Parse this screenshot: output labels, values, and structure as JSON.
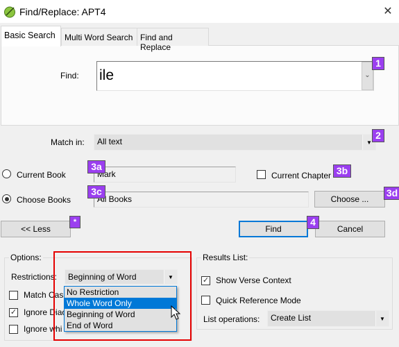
{
  "window": {
    "title": "Find/Replace: APT4",
    "close_glyph": "✕"
  },
  "tabs": [
    {
      "label": "Basic Search",
      "active": true
    },
    {
      "label": "Multi Word Search",
      "active": false
    },
    {
      "label": "Find and Replace",
      "active": false
    }
  ],
  "find": {
    "label": "Find:",
    "value": "ile",
    "dropdown_glyph": "⌄"
  },
  "match_in": {
    "label": "Match in:",
    "value": "All text"
  },
  "scope": {
    "current_book": {
      "label": "Current Book",
      "selected": false,
      "value": "Mark"
    },
    "choose_books": {
      "label": "Choose Books",
      "selected": true,
      "value": "All Books"
    },
    "current_chapter": {
      "label": "Current Chapter",
      "checked": false
    },
    "choose_button": "Choose ..."
  },
  "buttons": {
    "less": "<< Less",
    "find": "Find",
    "cancel": "Cancel"
  },
  "options": {
    "title": "Options:",
    "restrictions_label": "Restrictions:",
    "restrictions_value": "Beginning of Word",
    "restriction_options": [
      "No Restriction",
      "Whole Word Only",
      "Beginning of Word",
      "End of Word"
    ],
    "highlighted_option": "Whole Word Only",
    "checkboxes": [
      {
        "label": "Match Case",
        "visible_label": "Match Cas",
        "checked": false
      },
      {
        "label": "Ignore Diacritics",
        "visible_label": "Ignore Diac",
        "checked": true
      },
      {
        "label": "Ignore whitespace",
        "visible_label": "Ignore whi",
        "checked": false
      }
    ]
  },
  "results_list": {
    "title": "Results List:",
    "show_verse_context": {
      "label": "Show Verse Context",
      "checked": true
    },
    "quick_reference_mode": {
      "label": "Quick Reference Mode",
      "checked": false
    },
    "list_operations_label": "List operations:",
    "list_operations_value": "Create List"
  },
  "annotations": {
    "find_box": "1",
    "match_in": "2",
    "current_book": "3a",
    "current_chapter": "3b",
    "choose_books": "3c",
    "choose_button": "3d",
    "less_button": "*",
    "find_button": "4",
    "badge_color": "#9b3ff0",
    "highlight_color": "#e50000"
  },
  "glyphs": {
    "check": "✓",
    "down_arrow": "▼"
  }
}
